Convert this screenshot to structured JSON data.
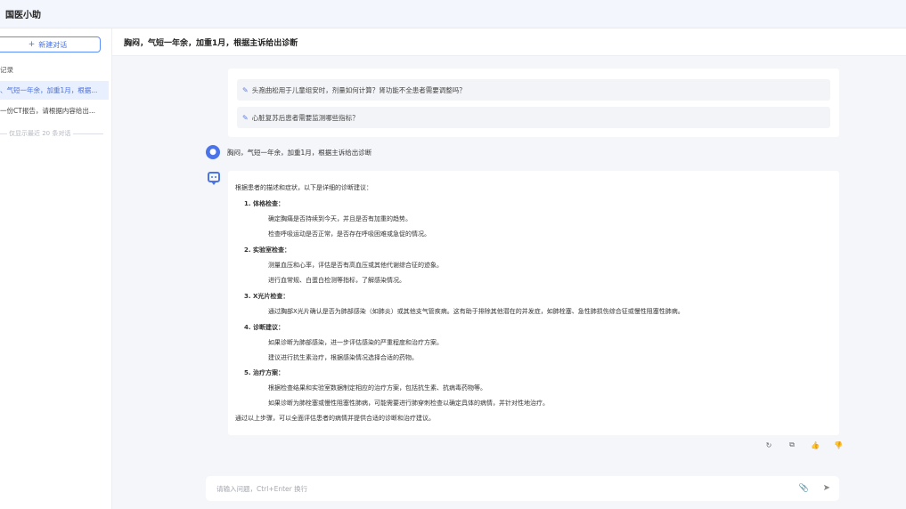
{
  "app": {
    "title": "国医小助"
  },
  "sidebar": {
    "new_chat_label": "新建对话",
    "history_heading": "记录",
    "items": [
      {
        "label": "、气短一年余，加重1月，根据...",
        "active": true
      },
      {
        "label": "一份CT报告，请根据内容给出...",
        "active": false
      }
    ],
    "note": "仅显示最近 20 条对话"
  },
  "conversation": {
    "title": "胸闷，气短一年余，加重1月，根据主诉给出诊断",
    "suggestions": [
      "头孢曲松用于儿童组安时，剂量如何计算？肾功能不全患者需要调整吗？",
      "心脏复苏后患者需要监测哪些指标？"
    ],
    "user_message": "胸闷，气短一年余，加重1月，根据主诉给出诊断",
    "answer": {
      "intro": "根据患者的描述和症状，以下是详细的诊断建议：",
      "sections": [
        {
          "heading": "1. 体格检查：",
          "details": [
            "确定胸痛是否持续到今天，并且是否有加重的趋势。",
            "检查呼吸运动是否正常，是否存在呼吸困难或急促的情况。"
          ]
        },
        {
          "heading": "2. 实验室检查：",
          "details": [
            "测量血压和心率，评估是否有高血压或其他代谢综合征的迹象。",
            "进行血常规、白蛋白检测等指标，了解感染情况。"
          ]
        },
        {
          "heading": "3. X光片检查：",
          "details": [
            "通过胸部X光片确认是否为肺部感染（如肺炎）或其他支气管疾病。这有助于排除其他潜在的并发症，如肺栓塞、急性肺损伤综合征或慢性阻塞性肺病。"
          ]
        },
        {
          "heading": "4. 诊断建议：",
          "details": [
            "如果诊断为肺部感染，进一步评估感染的严重程度和治疗方案。",
            "建议进行抗生素治疗，根据感染情况选择合适的药物。"
          ]
        },
        {
          "heading": "5. 治疗方案：",
          "details": [
            "根据检查结果和实验室数据制定相应的治疗方案，包括抗生素、抗病毒药物等。",
            "如果诊断为肺栓塞或慢性阻塞性肺病，可能需要进行肺穿刺检查以确定具体的病情，并针对性地治疗。"
          ]
        }
      ],
      "outro": "通过以上步骤，可以全面评估患者的病情并提供合适的诊断和治疗建议。"
    },
    "input_placeholder": "请输入问题，Ctrl+Enter 换行"
  },
  "icons": {
    "plus": "plus-icon",
    "pen": "pen-icon",
    "avatar": "user-avatar-icon",
    "bot": "chat-bubble-icon",
    "regenerate": "refresh-icon",
    "copy": "copy-icon",
    "like": "thumbs-up-icon",
    "dislike": "thumbs-down-icon",
    "attach": "paperclip-icon",
    "send": "send-icon"
  },
  "colors": {
    "accent": "#4b74e8",
    "active_bg": "#e8efff"
  }
}
